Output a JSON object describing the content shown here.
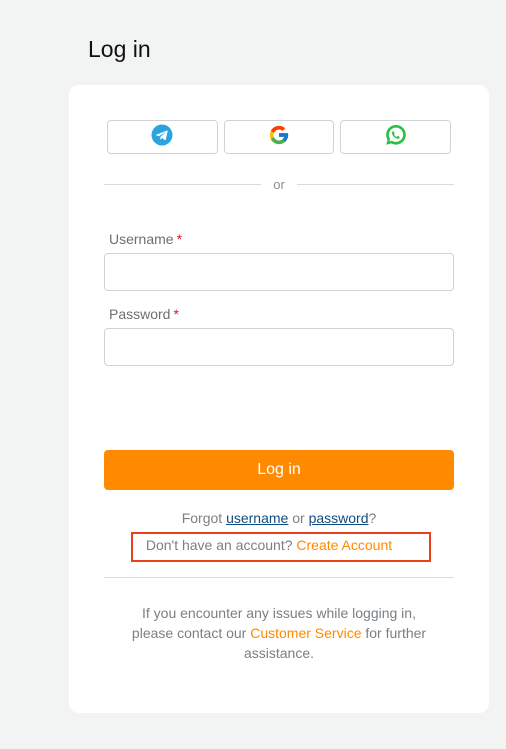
{
  "page": {
    "title": "Log in"
  },
  "social": {
    "buttons": [
      {
        "name": "telegram",
        "icon": "telegram-icon",
        "color": "#2aa3df"
      },
      {
        "name": "google",
        "icon": "google-icon"
      },
      {
        "name": "whatsapp",
        "icon": "whatsapp-icon",
        "color": "#25c243"
      }
    ],
    "divider_text": "or"
  },
  "form": {
    "username_label": "Username",
    "password_label": "Password",
    "required_mark": "*",
    "username_value": "",
    "password_value": "",
    "login_label": "Log in"
  },
  "links": {
    "forgot_prefix": "Forgot",
    "username": "username",
    "or": "or",
    "password": "password",
    "question_mark": "?",
    "no_account": "Don't have an account?",
    "create_account": "Create Account"
  },
  "help": {
    "line_prefix": "If you encounter any issues while logging in, please contact our",
    "customer_service": "Customer Service",
    "line_suffix": "for further assistance."
  },
  "colors": {
    "accent": "#ff8a00",
    "link": "#0f4c81",
    "required": "#d11a2a",
    "highlight_box": "#e8401c",
    "background": "#f2f3f3"
  }
}
